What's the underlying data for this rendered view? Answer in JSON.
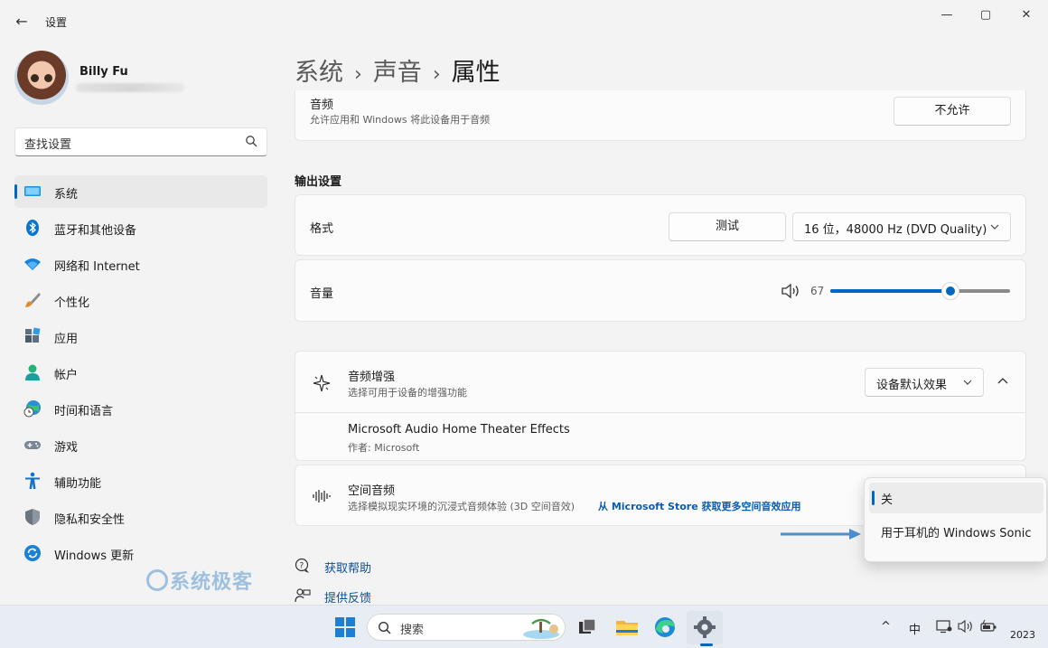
{
  "window": {
    "back_glyph": "←",
    "title": "设置",
    "minimize_glyph": "—",
    "maximize_glyph": "▢",
    "close_glyph": "✕"
  },
  "profile": {
    "name": "Billy Fu"
  },
  "search": {
    "placeholder": "查找设置"
  },
  "sidebar": {
    "items": [
      {
        "label": "系统",
        "icon": "system-icon",
        "active": true
      },
      {
        "label": "蓝牙和其他设备",
        "icon": "bluetooth-icon"
      },
      {
        "label": "网络和 Internet",
        "icon": "wifi-icon"
      },
      {
        "label": "个性化",
        "icon": "brush-icon"
      },
      {
        "label": "应用",
        "icon": "apps-icon"
      },
      {
        "label": "帐户",
        "icon": "account-icon"
      },
      {
        "label": "时间和语言",
        "icon": "globe-clock-icon"
      },
      {
        "label": "游戏",
        "icon": "gamepad-icon"
      },
      {
        "label": "辅助功能",
        "icon": "accessibility-icon"
      },
      {
        "label": "隐私和安全性",
        "icon": "shield-icon"
      },
      {
        "label": "Windows 更新",
        "icon": "update-icon"
      }
    ]
  },
  "watermark": "系统极客",
  "breadcrumb": {
    "items": [
      "系统",
      "声音",
      "属性"
    ],
    "separator": "›"
  },
  "audio_card": {
    "title": "音频",
    "subtitle": "允许应用和 Windows 将此设备用于音频",
    "button": "不允许"
  },
  "output_settings": {
    "heading": "输出设置",
    "format": {
      "label": "格式",
      "test_button": "测试",
      "selected": "16 位，48000 Hz (DVD Quality)"
    },
    "volume": {
      "label": "音量",
      "value": "67",
      "level": 0.67
    }
  },
  "enhance": {
    "title": "音频增强",
    "subtitle": "选择可用于设备的增强功能",
    "selected": "设备默认效果",
    "effect_name": "Microsoft Audio Home Theater Effects",
    "effect_author": "作者: Microsoft"
  },
  "spatial": {
    "title": "空间音频",
    "subtitle": "选择模拟现实环境的沉浸式音频体验 (3D 空间音效)",
    "link": "从 Microsoft Store 获取更多空间音效应用",
    "options": [
      "关",
      "用于耳机的 Windows Sonic"
    ],
    "selected_index": 0
  },
  "help": {
    "get_help": "获取帮助",
    "feedback": "提供反馈"
  },
  "taskbar": {
    "search_label": "搜索",
    "tray": {
      "chevron": "^",
      "ime": "中",
      "date": "2023"
    }
  },
  "colors": {
    "accent": "#0067c0",
    "link": "#0b5cad",
    "arrow": "#4a8fd0"
  }
}
